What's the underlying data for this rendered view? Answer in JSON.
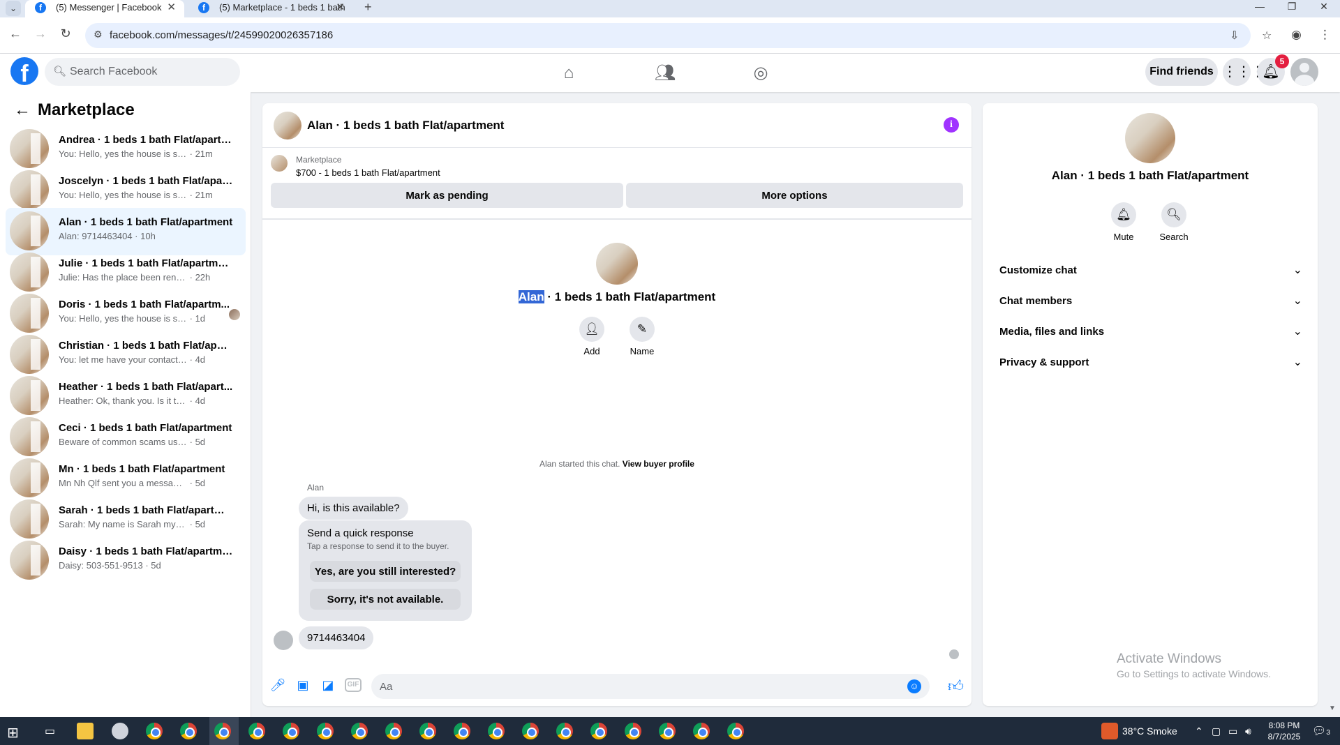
{
  "browser": {
    "tabs": [
      {
        "title": "(5) Messenger | Facebook",
        "active": true
      },
      {
        "title": "(5) Marketplace - 1 beds 1 bath",
        "active": false
      }
    ],
    "url": "facebook.com/messages/t/24599020026357186"
  },
  "header": {
    "search_placeholder": "Search Facebook",
    "find_friends": "Find friends",
    "notification_count": "5"
  },
  "sidebar": {
    "title": "Marketplace",
    "conversations": [
      {
        "name": "Andrea · 1 beds 1 bath Flat/apartm...",
        "preview": "You: Hello, yes the house is still avail...",
        "time": "· 21m"
      },
      {
        "name": "Joscelyn · 1 beds 1 bath Flat/apart...",
        "preview": "You: Hello, yes the house is still avail...",
        "time": "· 21m"
      },
      {
        "name": "Alan · 1 beds 1 bath Flat/apartment",
        "preview": "Alan: 9714463404",
        "time": "· 10h"
      },
      {
        "name": "Julie · 1 beds 1 bath Flat/apartment",
        "preview": "Julie: Has the place been rented?",
        "time": "· 22h"
      },
      {
        "name": "Doris · 1 beds 1 bath Flat/apartm...",
        "preview": "You: Hello, yes the house is still ava...",
        "time": "· 1d"
      },
      {
        "name": "Christian · 1 beds 1 bath Flat/apart...",
        "preview": "You: let me have your contact number...",
        "time": "· 4d"
      },
      {
        "name": "Heather · 1 beds 1 bath Flat/apart...",
        "preview": "Heather: Ok, thank you. Is it truly only...",
        "time": "· 4d"
      },
      {
        "name": "Ceci · 1 beds 1 bath Flat/apartment",
        "preview": "Beware of common scams using pay...",
        "time": "· 5d"
      },
      {
        "name": "Mn · 1 beds 1 bath Flat/apartment",
        "preview": "Mn Nh Qlf sent you a message about ...",
        "time": "· 5d"
      },
      {
        "name": "Sarah · 1 beds 1 bath Flat/apartment",
        "preview": "Sarah: My name is Sarah my number i...",
        "time": "· 5d"
      },
      {
        "name": "Daisy · 1 beds 1 bath Flat/apartment",
        "preview": "Daisy: 503-551-9513",
        "time": "· 5d"
      }
    ]
  },
  "chat": {
    "title": "Alan · 1 beds 1 bath Flat/apartment",
    "listing_source": "Marketplace",
    "listing_price": "$700 - 1 beds 1 bath Flat/apartment",
    "mark_pending": "Mark as pending",
    "more_options": "More options",
    "profile_name_highlight": "Alan",
    "profile_name_rest": " · 1 beds 1 bath Flat/apartment",
    "add_label": "Add",
    "name_label": "Name",
    "started_text": "Alan started this chat.",
    "view_buyer": "View buyer profile",
    "sender": "Alan",
    "message1": "Hi, is this available?",
    "quick_title": "Send a quick response",
    "quick_subtitle": "Tap a response to send it to the buyer.",
    "quick_option1": "Yes, are you still interested?",
    "quick_option2": "Sorry, it's not available.",
    "message2": "9714463404",
    "composer_placeholder": "Aa"
  },
  "details": {
    "name": "Alan · 1 beds 1 bath Flat/apartment",
    "mute": "Mute",
    "search": "Search",
    "sections": [
      "Customize chat",
      "Chat members",
      "Media, files and links",
      "Privacy & support"
    ]
  },
  "watermark": {
    "line1": "Activate Windows",
    "line2": "Go to Settings to activate Windows."
  },
  "taskbar": {
    "weather": "38°C  Smoke",
    "time": "8:08 PM",
    "date": "8/7/2025",
    "notif_count": "3"
  }
}
